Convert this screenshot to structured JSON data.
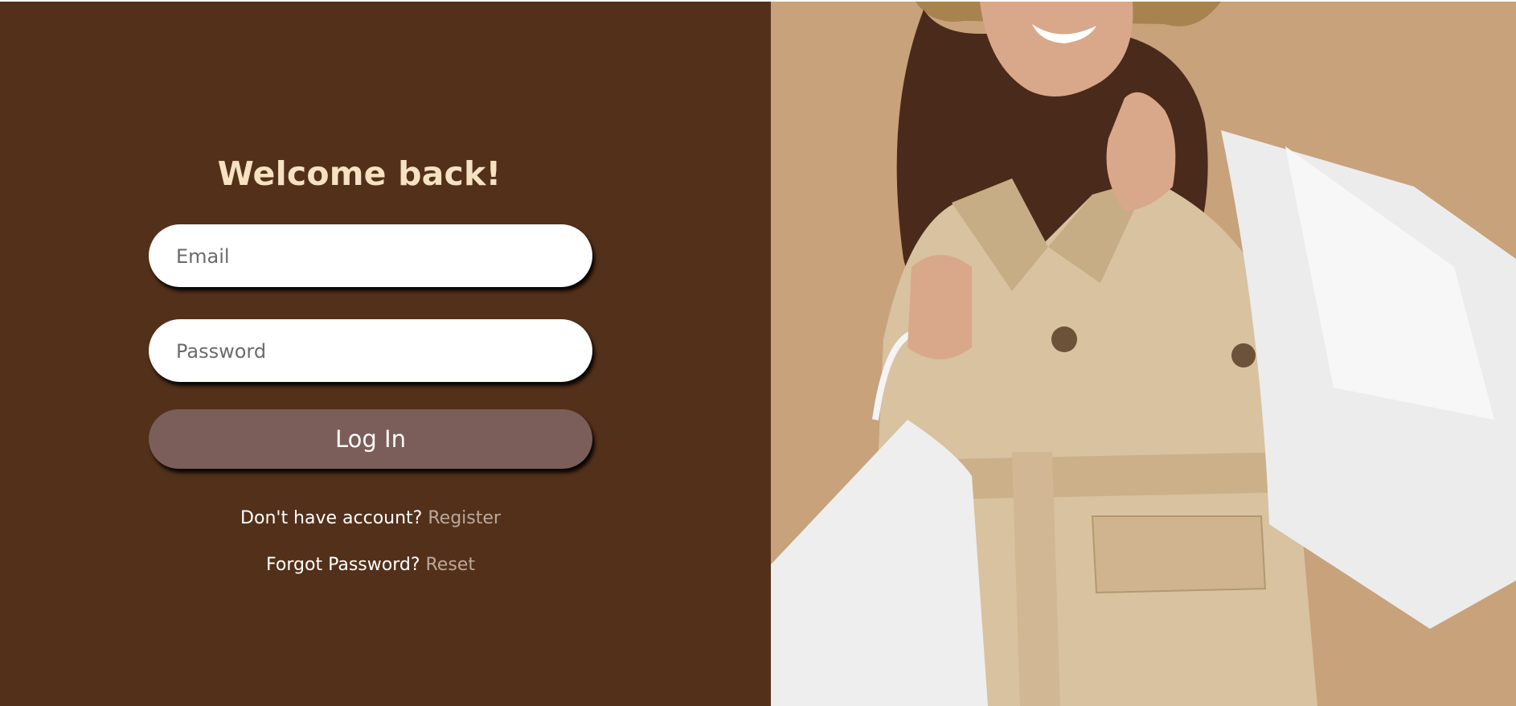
{
  "login": {
    "heading": "Welcome back!",
    "email_placeholder": "Email",
    "password_placeholder": "Password",
    "login_button": "Log In",
    "register_prompt": "Don't have account?",
    "register_link": "Register",
    "reset_prompt": "Forgot Password?",
    "reset_link": "Reset"
  },
  "hero": {
    "subject": "woman in beige trench coat and hat carrying white shopping bags"
  },
  "colors": {
    "panel": "#53301a",
    "heading": "#f6e2c3",
    "button": "#7b5d5a",
    "link": "#bba99a",
    "photo_background": "#c9a27a"
  }
}
